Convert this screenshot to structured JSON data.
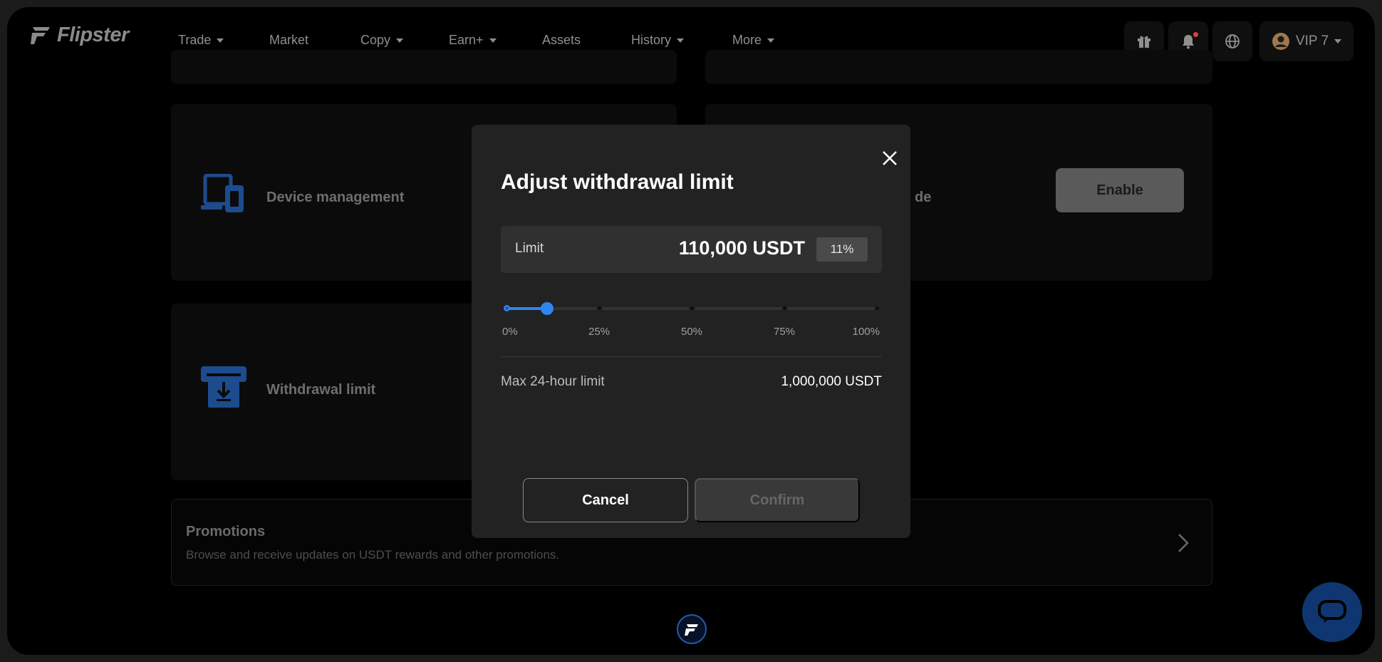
{
  "app": {
    "name": "Flipster"
  },
  "nav": {
    "items": [
      {
        "label": "Trade",
        "dropdown": true
      },
      {
        "label": "Market",
        "dropdown": false
      },
      {
        "label": "Copy",
        "dropdown": true
      },
      {
        "label": "Earn+",
        "dropdown": true
      },
      {
        "label": "Assets",
        "dropdown": false
      },
      {
        "label": "History",
        "dropdown": true
      },
      {
        "label": "More",
        "dropdown": true
      }
    ],
    "vip_label": "VIP 7"
  },
  "cards": {
    "device_management": "Device management",
    "withdrawal_limit": "Withdrawal limit",
    "partial_right_title": "de",
    "enable_label": "Enable"
  },
  "promotions": {
    "title": "Promotions",
    "description": "Browse and receive updates on USDT rewards and other promotions."
  },
  "modal": {
    "title": "Adjust withdrawal limit",
    "limit_label": "Limit",
    "limit_value": "110,000 USDT",
    "limit_percent": "11%",
    "slider": {
      "value_percent": 11,
      "marks": [
        "0%",
        "25%",
        "50%",
        "75%",
        "100%"
      ]
    },
    "max_label": "Max 24-hour limit",
    "max_value": "1,000,000 USDT",
    "cancel_label": "Cancel",
    "confirm_label": "Confirm"
  },
  "colors": {
    "accent": "#2f86ef",
    "modal_bg": "#222222",
    "page_bg": "#000000"
  }
}
